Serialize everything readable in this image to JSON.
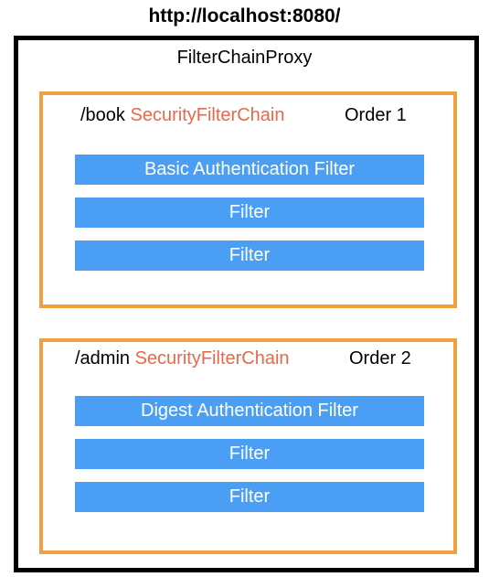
{
  "url": "http://localhost:8080/",
  "proxy_title": "FilterChainProxy",
  "chains": [
    {
      "path": "/book",
      "name": "SecurityFilterChain",
      "order": "Order 1",
      "filters": [
        "Basic Authentication Filter",
        "Filter",
        "Filter"
      ]
    },
    {
      "path": "/admin",
      "name": "SecurityFilterChain",
      "order": "Order 2",
      "filters": [
        "Digest Authentication Filter",
        "Filter",
        "Filter"
      ]
    }
  ],
  "colors": {
    "outer_border": "#000000",
    "chain_border": "#f0a040",
    "chain_name": "#e8684a",
    "filter_fill": "#4a9ff5",
    "filter_text": "#ffffff"
  }
}
